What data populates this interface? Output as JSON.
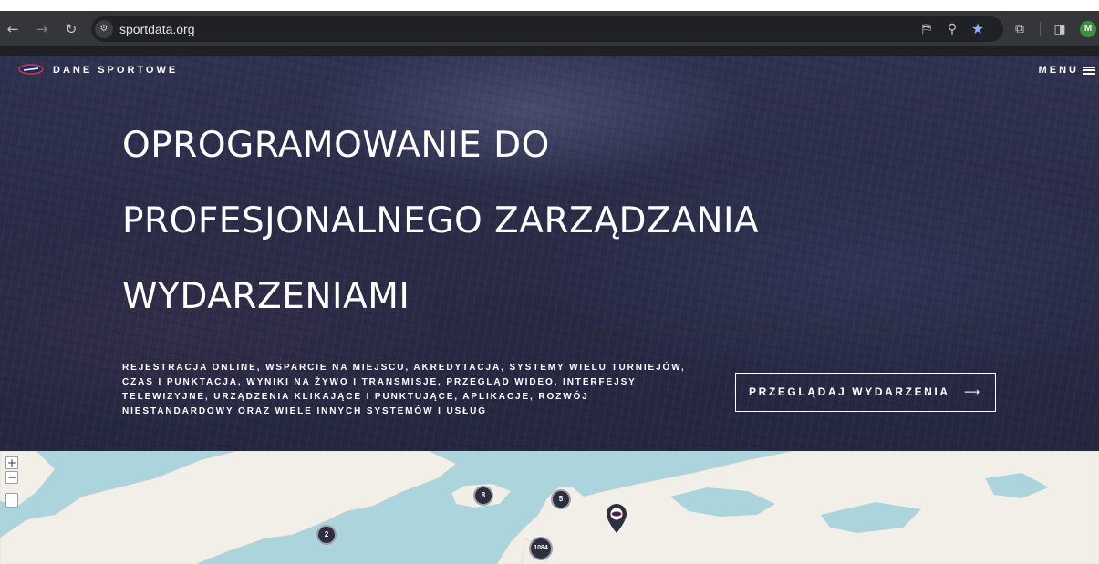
{
  "browser": {
    "url": "sportdata.org",
    "profile_initial": "M",
    "icons": {
      "back": "arrow-left-icon",
      "forward": "arrow-right-icon",
      "reload": "reload-icon",
      "site_info": "tune-icon",
      "translate": "translate-icon",
      "zoom": "zoom-icon",
      "bookmark": "star-icon",
      "extensions": "puzzle-icon",
      "sidepanel": "side-panel-icon"
    }
  },
  "header": {
    "brand": "DANE SPORTOWE",
    "menu_label": "MENU"
  },
  "hero": {
    "headline_lines": [
      "OPROGRAMOWANIE DO",
      "PROFESJONALNEGO ZARZĄDZANIA",
      "WYDARZENIAMI"
    ],
    "description_lines": [
      "REJESTRACJA ONLINE, WSPARCIE NA MIEJSCU, AKREDYTACJA, SYSTEMY WIELU TURNIEJÓW,",
      "CZAS I PUNKTACJA, WYNIKI NA ŻYWO I TRANSMISJE, PRZEGLĄD WIDEO, INTERFEJSY",
      "TELEWIZYJNE, URZĄDZENIA KLIKAJĄCE I PUNKTUJĄCE, APLIKACJE, ROZWÓJ",
      "NIESTANDARDOWY ORAZ WIELE INNYCH SYSTEMÓW I USŁUG"
    ],
    "cta_label": "PRZEGLĄDAJ WYDARZENIA",
    "cta_arrow": "⟶"
  },
  "map": {
    "zoom_in": "+",
    "zoom_out": "−",
    "clusters": [
      "8",
      "5",
      "2",
      "1084"
    ]
  },
  "colors": {
    "hero_overlay": "#2a2c47",
    "map_water": "#acd4dd",
    "map_land": "#f2efe9",
    "cluster": "#2d2f3f"
  }
}
